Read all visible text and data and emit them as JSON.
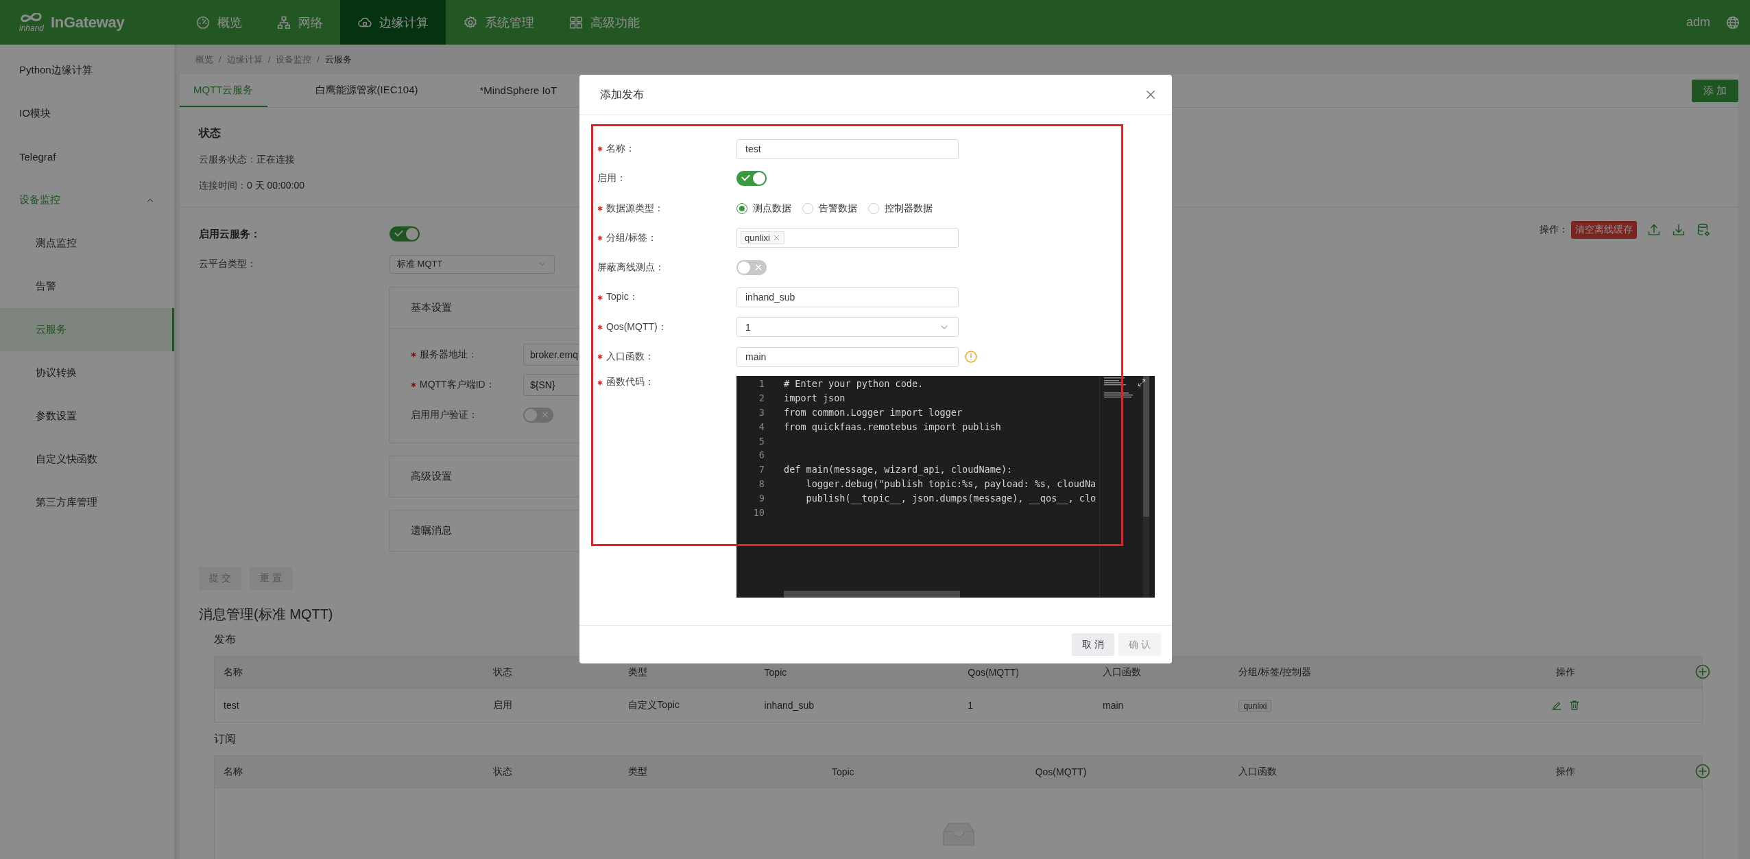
{
  "topbar": {
    "logo_text": "inhand",
    "brand": "InGateway",
    "nav": [
      {
        "label": "概览",
        "selected": false
      },
      {
        "label": "网络",
        "selected": false
      },
      {
        "label": "边缘计算",
        "selected": true
      },
      {
        "label": "系统管理",
        "selected": false
      },
      {
        "label": "高级功能",
        "selected": false
      }
    ],
    "user": "adm"
  },
  "sidebar": {
    "items": [
      {
        "label": "Python边缘计算",
        "selected": false
      },
      {
        "label": "IO模块",
        "selected": false
      },
      {
        "label": "Telegraf",
        "selected": false
      },
      {
        "label": "设备监控",
        "selected": false,
        "expanded": true,
        "children": [
          {
            "label": "测点监控",
            "selected": false
          },
          {
            "label": "告警",
            "selected": false
          },
          {
            "label": "云服务",
            "selected": true
          },
          {
            "label": "协议转换",
            "selected": false
          },
          {
            "label": "参数设置",
            "selected": false
          },
          {
            "label": "自定义快函数",
            "selected": false
          },
          {
            "label": "第三方库管理",
            "selected": false
          }
        ]
      }
    ]
  },
  "breadcrumb": {
    "separator": "/",
    "items": [
      "概览",
      "边缘计算",
      "设备监控",
      "云服务"
    ]
  },
  "tabs": [
    {
      "label": "MQTT云服务",
      "selected": true
    },
    {
      "label": "白鹰能源管家(IEC104)",
      "selected": false
    },
    {
      "label": "*MindSphere IoT",
      "selected": false
    }
  ],
  "add_button": "添 加",
  "status": {
    "title": "状态",
    "lines": [
      {
        "label": "云服务状态：",
        "value": "正在连接"
      },
      {
        "label": "连接时间：",
        "value": "0 天 00:00:00"
      }
    ]
  },
  "cloud": {
    "enable_label": "启用云服务：",
    "enabled": true,
    "platform_label": "云平台类型：",
    "platform": "标准 MQTT",
    "ops_label": "操作：",
    "clear_button": "清空离线缓存"
  },
  "sections": [
    {
      "title": "基本设置",
      "fields": [
        {
          "kind": "input",
          "label": "服务器地址：",
          "required": true,
          "value": "broker.emq"
        },
        {
          "kind": "input",
          "label": "MQTT客户端ID：",
          "required": true,
          "value": "${SN}"
        },
        {
          "kind": "switch",
          "label": "启用用户验证：",
          "required": false,
          "on": false
        }
      ]
    },
    {
      "title": "高级设置"
    },
    {
      "title": "遗嘱消息"
    }
  ],
  "form_buttons": [
    {
      "label": "提 交",
      "disabled": true
    },
    {
      "label": "重 置",
      "disabled": true
    }
  ],
  "messages": {
    "title": "消息管理(标准 MQTT)",
    "publish": {
      "title": "发布",
      "columns": [
        "名称",
        "状态",
        "类型",
        "Topic",
        "Qos(MQTT)",
        "入口函数",
        "分组/标签/控制器",
        "操作"
      ],
      "rows": [
        {
          "cells": [
            "test",
            "启用",
            "自定义Topic",
            "inhand_sub",
            "1",
            "main"
          ],
          "tags": [
            "qunlixi"
          ]
        }
      ]
    },
    "subscribe": {
      "title": "订阅",
      "columns": [
        "名称",
        "状态",
        "类型",
        "Topic",
        "Qos(MQTT)",
        "入口函数",
        "操作"
      ]
    }
  },
  "modal": {
    "title": "添加发布",
    "fields": [
      {
        "kind": "input",
        "label": "名称：",
        "required": true,
        "value": "test"
      },
      {
        "kind": "switch",
        "label": "启用：",
        "required": false,
        "on": true
      },
      {
        "kind": "radio",
        "label": "数据源类型：",
        "required": true,
        "options": [
          {
            "label": "测点数据",
            "selected": true
          },
          {
            "label": "告警数据",
            "selected": false
          },
          {
            "label": "控制器数据",
            "selected": false
          }
        ]
      },
      {
        "kind": "tags",
        "label": "分组/标签：",
        "required": true,
        "tags": [
          "qunlixi"
        ]
      },
      {
        "kind": "switch",
        "label": "屏蔽离线测点：",
        "required": false,
        "on": false
      },
      {
        "kind": "input",
        "label": "Topic：",
        "required": true,
        "value": "inhand_sub"
      },
      {
        "kind": "select",
        "label": "Qos(MQTT)：",
        "required": true,
        "value": "1"
      },
      {
        "kind": "input",
        "label": "入口函数：",
        "required": true,
        "value": "main",
        "warning": true
      },
      {
        "kind": "code",
        "label": "函数代码：",
        "required": true,
        "lines": [
          {
            "number": "1",
            "text": "# Enter your python code."
          },
          {
            "number": "2",
            "text": "import json"
          },
          {
            "number": "3",
            "text": "from common.Logger import logger"
          },
          {
            "number": "4",
            "text": "from quickfaas.remotebus import publish"
          },
          {
            "number": "5"
          },
          {
            "number": "6"
          },
          {
            "number": "7",
            "text": "def main(message, wizard_api, cloudName):"
          },
          {
            "number": "8",
            "text": "    logger.debug(\"publish topic:%s, payload: %s, cloudNa"
          },
          {
            "number": "9",
            "text": "    publish(__topic__, json.dumps(message), __qos__, clo"
          },
          {
            "number": "10"
          }
        ]
      }
    ],
    "buttons": [
      {
        "label": "取 消",
        "disabled": false
      },
      {
        "label": "确 认",
        "disabled": true
      }
    ]
  }
}
